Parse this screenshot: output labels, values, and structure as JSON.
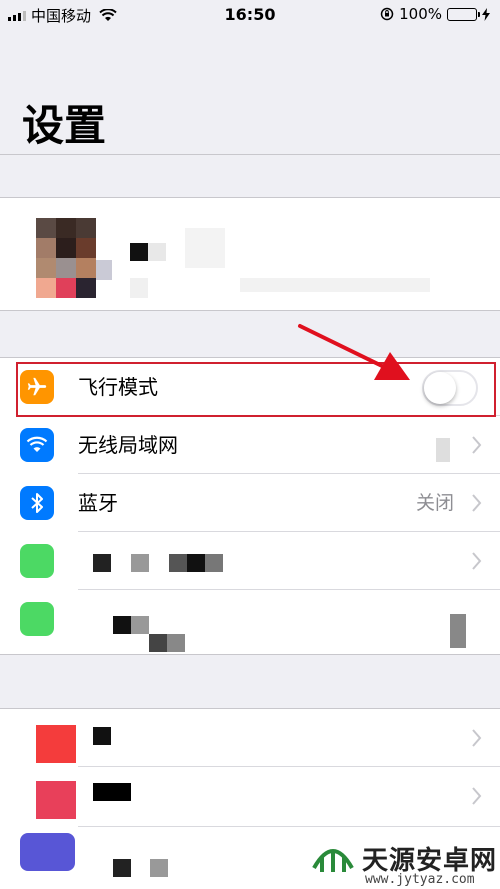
{
  "status_bar": {
    "carrier": "中国移动",
    "time": "16:50",
    "battery_percent": "100%",
    "battery_color": "#4cd964"
  },
  "page_title": "设置",
  "settings_rows": [
    {
      "label": "飞行模式",
      "icon": "airplane-icon",
      "icon_color": "#ff9500",
      "toggle_on": false
    },
    {
      "label": "无线局域网",
      "icon": "wifi-icon",
      "icon_color": "#007aff"
    },
    {
      "label": "蓝牙",
      "icon": "bluetooth-icon",
      "icon_color": "#007aff",
      "value": "关闭"
    }
  ],
  "annotation": {
    "highlight_color": "#d0202f"
  },
  "watermark": {
    "title": "天源安卓网",
    "url": "www.jytyaz.com"
  }
}
